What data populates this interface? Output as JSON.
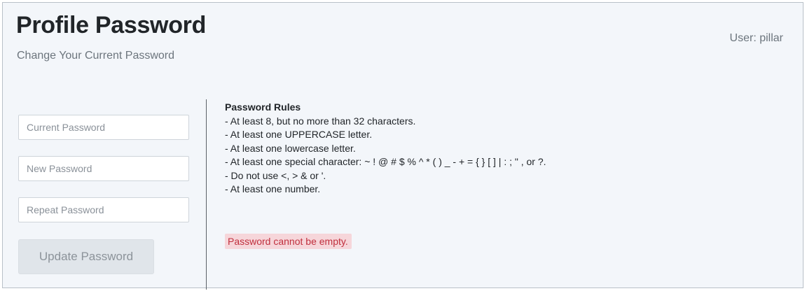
{
  "header": {
    "title": "Profile Password",
    "subtitle": "Change Your Current Password",
    "user_label": "User: pillar"
  },
  "form": {
    "current_password": {
      "placeholder": "Current Password",
      "value": ""
    },
    "new_password": {
      "placeholder": "New Password",
      "value": ""
    },
    "repeat_password": {
      "placeholder": "Repeat Password",
      "value": ""
    },
    "submit_label": "Update Password",
    "submit_disabled": true
  },
  "rules": {
    "title": "Password Rules",
    "items": [
      "- At least 8, but no more than 32 characters.",
      "- At least one UPPERCASE letter.",
      "- At least one lowercase letter.",
      "- At least one special character: ~ ! @ # $ % ^ * ( ) _ - + = { } [ ] | : ; \" , or ?.",
      "- Do not use <, > & or '.",
      "- At least one number."
    ]
  },
  "error": {
    "message": "Password cannot be empty."
  },
  "colors": {
    "panel_bg": "#f3f6fa",
    "error_bg": "#f6d6da",
    "error_text": "#c0303e",
    "button_disabled_bg": "#e0e5ea"
  }
}
